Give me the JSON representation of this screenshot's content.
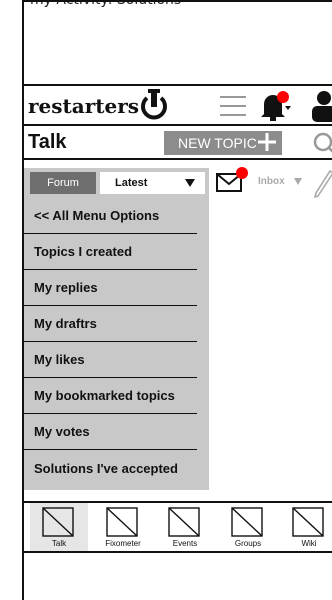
{
  "caption": "my Activity: Solutions",
  "header": {
    "logo_text": "restarters",
    "notification_dot_color": "#ff0000"
  },
  "talkbar": {
    "title": "Talk",
    "new_topic_label": "NEW TOPIC"
  },
  "filter": {
    "tab_forum": "Forum",
    "tab_latest": "Latest"
  },
  "menu": {
    "items": [
      "<< All Menu Options",
      "Topics I created",
      "My replies",
      "My draftrs",
      "My likes",
      "My bookmarked topics",
      "My votes",
      "Solutions I've accepted"
    ]
  },
  "messages": {
    "inbox_label": "Inbox"
  },
  "bottom_nav": {
    "items": [
      "Talk",
      "Fixometer",
      "Events",
      "Groups",
      "Wiki"
    ],
    "active": "Talk"
  }
}
